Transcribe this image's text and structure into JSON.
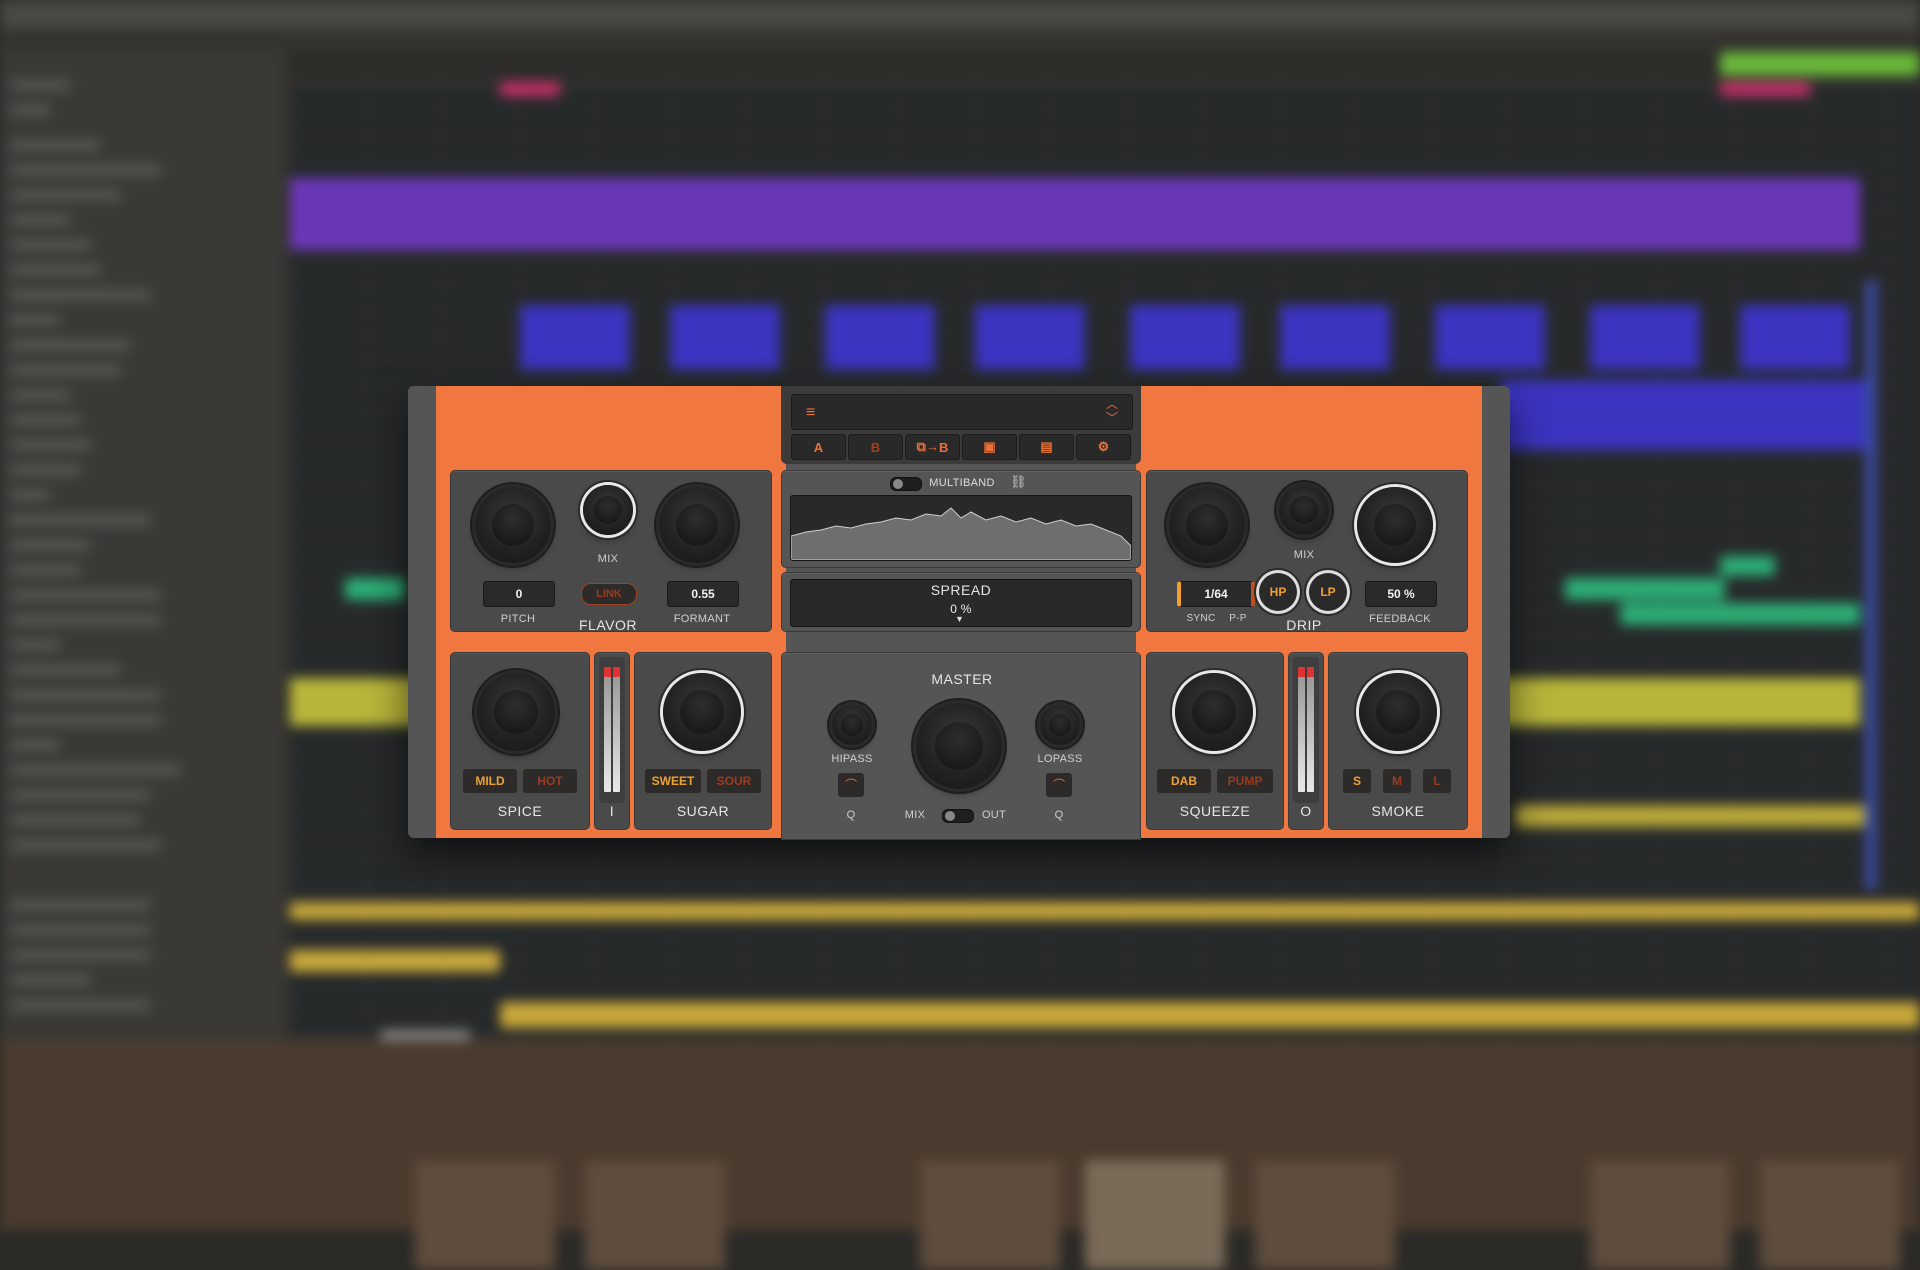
{
  "plugin": {
    "preset_menu_icon": "hamburger-icon",
    "preset_nav_icon": "up-down-chevron-icon",
    "ab_buttons": [
      {
        "label": "A",
        "icon": ""
      },
      {
        "label": "B",
        "icon": ""
      },
      {
        "label": "B",
        "icon": "copy-ab-icon"
      },
      {
        "label": "",
        "icon": "save-icon"
      },
      {
        "label": "",
        "icon": "calendar-icon"
      },
      {
        "label": "",
        "icon": "gear-icon"
      }
    ],
    "flavor": {
      "title": "FLAVOR",
      "pitch_label": "PITCH",
      "pitch_value": "0",
      "mix_label": "MIX",
      "link_label": "LINK",
      "formant_label": "FORMANT",
      "formant_value": "0.55"
    },
    "multiband": {
      "label": "MULTIBAND"
    },
    "spread": {
      "title": "SPREAD",
      "value": "0 %"
    },
    "drip": {
      "title": "DRIP",
      "mix_label": "MIX",
      "sync_value": "1/64",
      "sync_label": "SYNC",
      "pp_label": "P-P",
      "hp_label": "HP",
      "lp_label": "LP",
      "feedback_label": "FEEDBACK",
      "feedback_value": "50 %"
    },
    "spice": {
      "title": "SPICE",
      "mild": "MILD",
      "hot": "HOT"
    },
    "input_meter_label": "I",
    "sugar": {
      "title": "SUGAR",
      "sweet": "SWEET",
      "sour": "SOUR"
    },
    "master": {
      "title": "MASTER",
      "hipass_label": "HIPASS",
      "lopass_label": "LOPASS",
      "q_left": "Q",
      "q_right": "Q",
      "mix_label": "MIX",
      "out_label": "OUT"
    },
    "squeeze": {
      "title": "SQUEEZE",
      "dab": "DAB",
      "pump": "PUMP"
    },
    "output_meter_label": "O",
    "smoke": {
      "title": "SMOKE",
      "s": "S",
      "m": "M",
      "l": "L"
    }
  },
  "colors": {
    "orange": "#f0773f",
    "panel": "#4a4a4a",
    "accent_text": "#f0a030"
  }
}
